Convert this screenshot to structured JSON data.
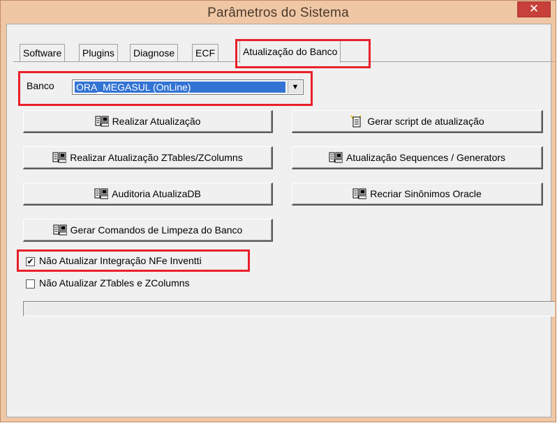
{
  "window": {
    "title": "Parâmetros do Sistema",
    "close": "✕"
  },
  "tabs": [
    "Software",
    "Plugins",
    "Diagnose",
    "ECF",
    "Atualização do Banco"
  ],
  "active_tab": "Atualização do Banco",
  "banco": {
    "label": "Banco",
    "value": "ORA_MEGASUL (OnLine)",
    "arrow": "▼"
  },
  "buttons": {
    "realizar": "Realizar Atualização",
    "gerar_script": "Gerar script de atualização",
    "realizar_ztables": "Realizar Atualização ZTables/ZColumns",
    "sequences": "Atualização Sequences / Generators",
    "auditoria": "Auditoria AtualizaDB",
    "sinonimos": "Recriar Sinônimos Oracle",
    "limpeza": "Gerar Comandos de Limpeza do Banco"
  },
  "checkboxes": [
    {
      "label": "Não Atualizar Integração NFe Inventti",
      "checked": true
    },
    {
      "label": "Não Atualizar ZTables e ZColumns",
      "checked": false
    }
  ],
  "progress": {
    "percent": 0
  },
  "colors": {
    "highlight": "#e8202a",
    "selection": "#3273d4",
    "frame": "#f0c7a5"
  },
  "icons": {
    "db_button": "database-icon",
    "script_button": "script-icon"
  }
}
